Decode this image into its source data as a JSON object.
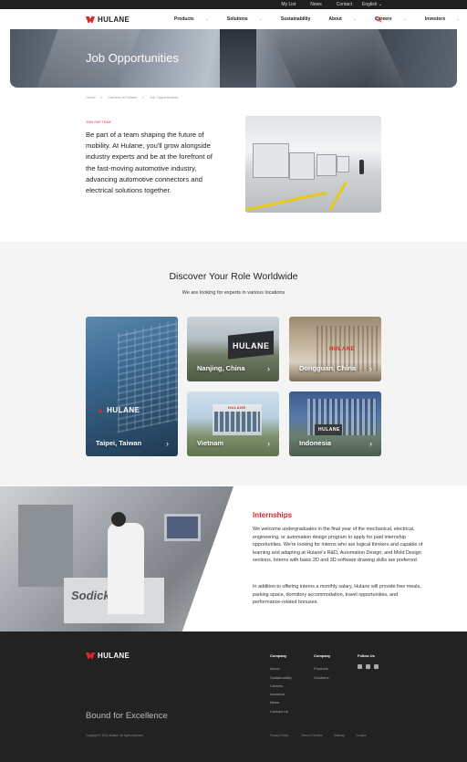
{
  "topbar": {
    "links": [
      "My List",
      "News",
      "Contact"
    ],
    "language": "English"
  },
  "brand": {
    "name": "HULANE",
    "color": "#d6282f"
  },
  "nav": {
    "items": [
      "Products",
      "Solutions",
      "Sustainability",
      "About",
      "Careers",
      "Investors"
    ],
    "search_icon": "search-icon"
  },
  "hero": {
    "title": "Job Opportunities"
  },
  "breadcrumb": [
    "Home",
    "Careers at Hulane",
    "Job Opportunities"
  ],
  "intro": {
    "tag": "JOIN OUR TEAM",
    "text": "Be part of a team shaping the future of mobility. At Hulane, you'll grow alongside industry experts and be at the forefront of the fast-moving automotive industry, advancing automotive connectors and electrical solutions together."
  },
  "roles": {
    "title": "Discover Your Role Worldwide",
    "subtitle": "We are looking for experts in various locations",
    "locations": [
      "Taipei, Taiwan",
      "Nanjing, China",
      "Dongguan, China",
      "Vietnam",
      "Indonesia"
    ]
  },
  "internships": {
    "title": "Internships",
    "p1": "We welcome undergraduates in the final year of the mechanical, electrical, engineering, or automation design program to apply for paid internship opportunities. We're looking for interns who are logical thinkers and capable of learning and adapting at Hulane's R&D, Automation Design, and Mold Design sections. Interns with basic 2D and 3D software drawing skills are preferred.",
    "p2": "In addition to offering interns a monthly salary, Hulane will provide free meals, parking space, dormitory accommodation, travel opportunities, and performance-related bonuses."
  },
  "footer": {
    "company1": {
      "heading": "Company",
      "links": [
        "About",
        "Sustainability",
        "Careers",
        "Investors",
        "News",
        "Contact Us"
      ]
    },
    "company2": {
      "heading": "Company",
      "links": [
        "Products",
        "Solutions"
      ]
    },
    "follow": {
      "heading": "Follow Us"
    },
    "tagline": "Bound for Excellence",
    "copyright": "Copyright © 2024 Hulane. All rights reserved.",
    "legal": [
      "Privacy Policy",
      "Terms of Service",
      "Sitemap",
      "Cookies"
    ]
  }
}
